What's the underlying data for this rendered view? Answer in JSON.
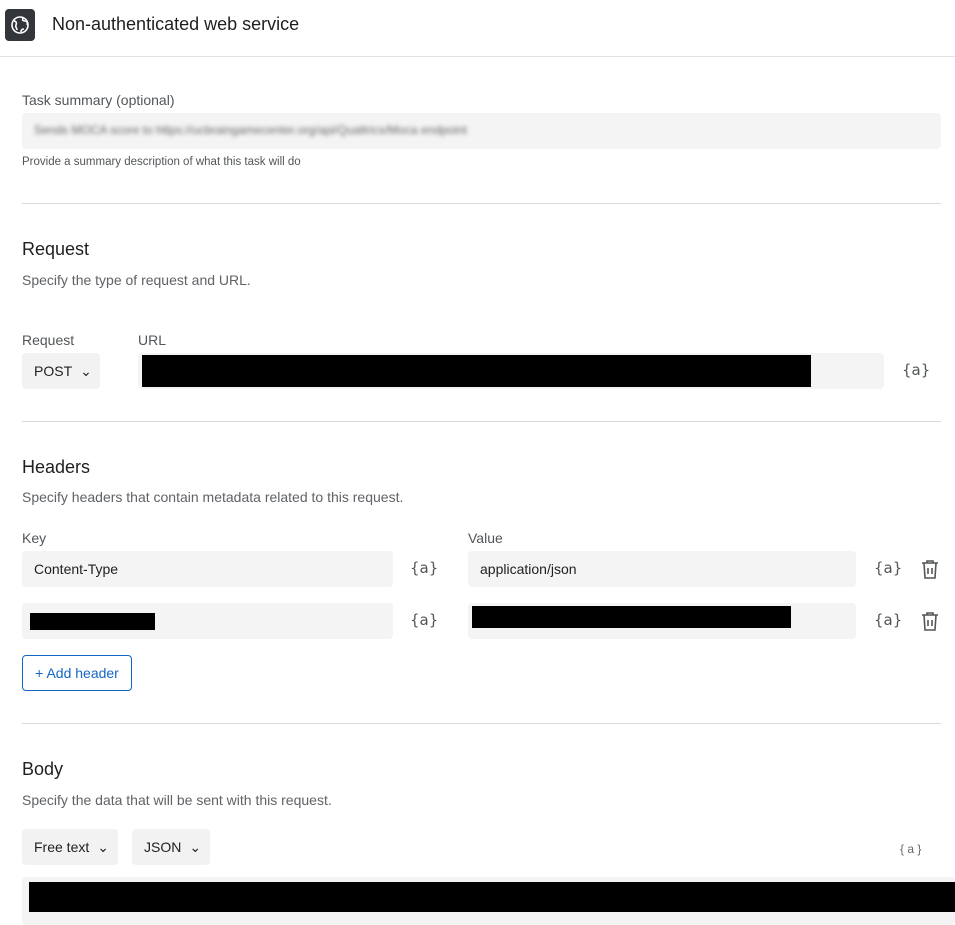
{
  "header": {
    "title": "Non-authenticated web service",
    "icon": "globe-icon"
  },
  "summary": {
    "label": "Task summary (optional)",
    "value": "Sends MOCA score to https://ucbraingamecenter.org/api/Qualtrics/Moca endpoint",
    "help": "Provide a summary description of what this task will do"
  },
  "request": {
    "title": "Request",
    "subtitle": "Specify the type of request and URL.",
    "method_label": "Request",
    "method": "POST",
    "url_label": "URL"
  },
  "headers": {
    "title": "Headers",
    "subtitle": "Specify headers that contain metadata related to this request.",
    "key_label": "Key",
    "value_label": "Value",
    "rows": [
      {
        "key": "Content-Type",
        "value": "application/json"
      }
    ],
    "add_label": "+ Add header"
  },
  "body": {
    "title": "Body",
    "subtitle": "Specify the data that will be sent with this request.",
    "format": "Free text",
    "type": "JSON"
  },
  "piped_text": "{a}",
  "piped_text_spaced": "{ a }"
}
